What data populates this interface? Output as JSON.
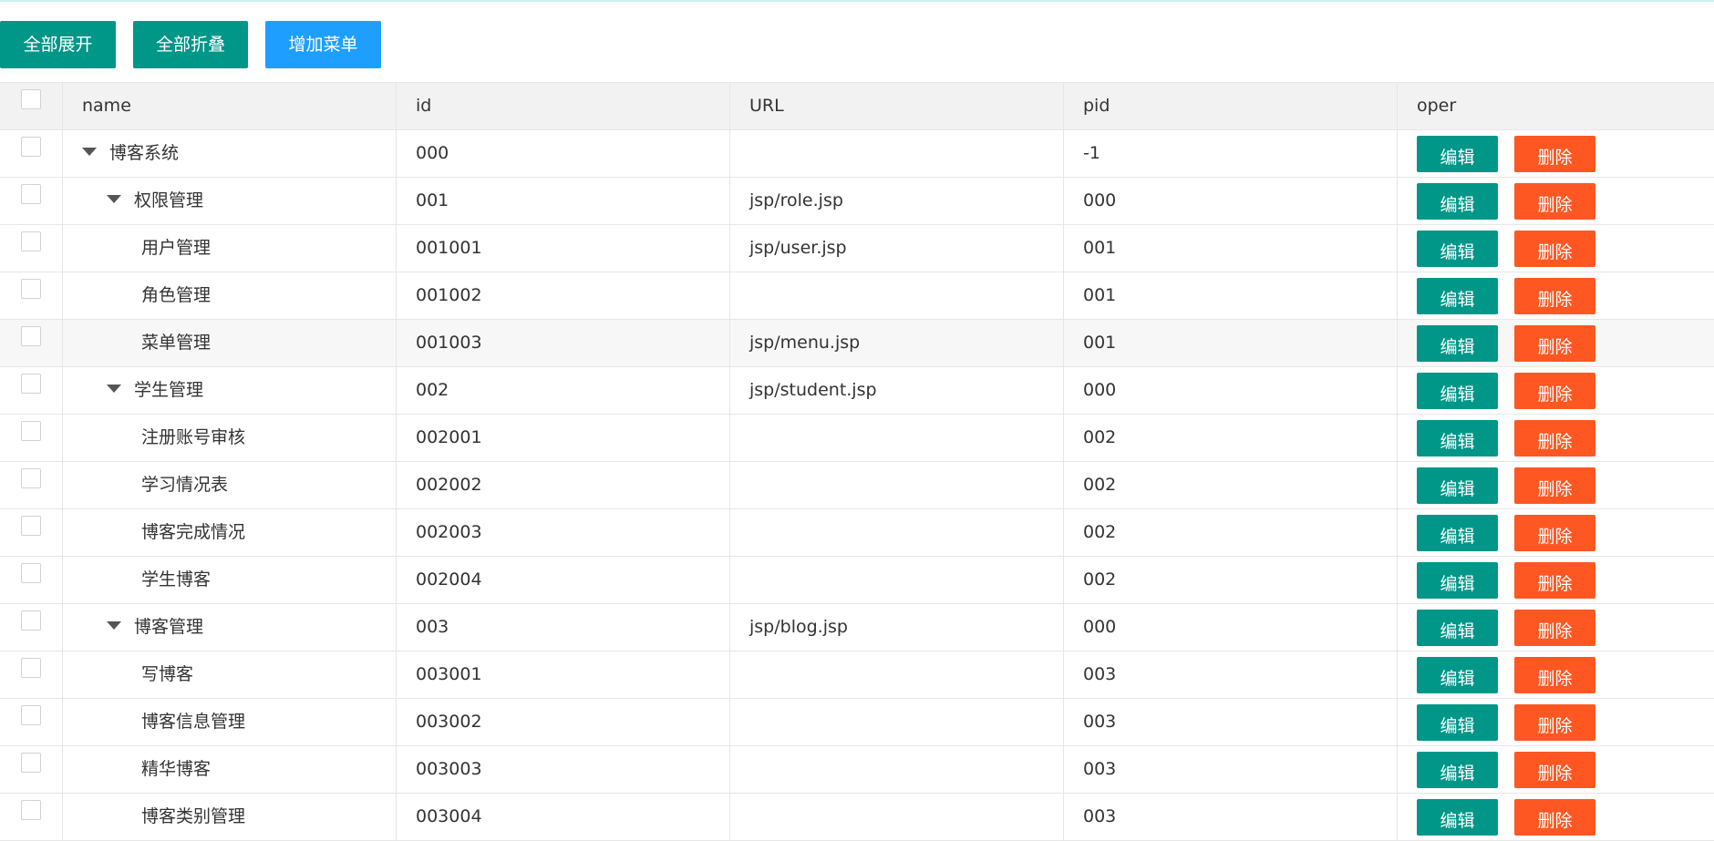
{
  "toolbar": {
    "expand_all": "全部展开",
    "collapse_all": "全部折叠",
    "add_menu": "增加菜单"
  },
  "table": {
    "columns": [
      "name",
      "id",
      "URL",
      "pid",
      "oper"
    ],
    "edit_label": "编辑",
    "delete_label": "删除",
    "rows": [
      {
        "name": "博客系统",
        "id": "000",
        "url": "",
        "pid": "-1",
        "level": 0,
        "expanded": true
      },
      {
        "name": "权限管理",
        "id": "001",
        "url": "jsp/role.jsp",
        "pid": "000",
        "level": 1,
        "expanded": true
      },
      {
        "name": "用户管理",
        "id": "001001",
        "url": "jsp/user.jsp",
        "pid": "001",
        "level": 2
      },
      {
        "name": "角色管理",
        "id": "001002",
        "url": "",
        "pid": "001",
        "level": 2
      },
      {
        "name": "菜单管理",
        "id": "001003",
        "url": "jsp/menu.jsp",
        "pid": "001",
        "level": 2
      },
      {
        "name": "学生管理",
        "id": "002",
        "url": "jsp/student.jsp",
        "pid": "000",
        "level": 1,
        "expanded": true
      },
      {
        "name": "注册账号审核",
        "id": "002001",
        "url": "",
        "pid": "002",
        "level": 2
      },
      {
        "name": "学习情况表",
        "id": "002002",
        "url": "",
        "pid": "002",
        "level": 2
      },
      {
        "name": "博客完成情况",
        "id": "002003",
        "url": "",
        "pid": "002",
        "level": 2
      },
      {
        "name": "学生博客",
        "id": "002004",
        "url": "",
        "pid": "002",
        "level": 2
      },
      {
        "name": "博客管理",
        "id": "003",
        "url": "jsp/blog.jsp",
        "pid": "000",
        "level": 1,
        "expanded": true
      },
      {
        "name": "写博客",
        "id": "003001",
        "url": "",
        "pid": "003",
        "level": 2
      },
      {
        "name": "博客信息管理",
        "id": "003002",
        "url": "",
        "pid": "003",
        "level": 2
      },
      {
        "name": "精华博客",
        "id": "003003",
        "url": "",
        "pid": "003",
        "level": 2
      },
      {
        "name": "博客类别管理",
        "id": "003004",
        "url": "",
        "pid": "003",
        "level": 2
      }
    ]
  },
  "colors": {
    "teal": "#009688",
    "blue": "#1e9fff",
    "orange": "#ff5722"
  }
}
